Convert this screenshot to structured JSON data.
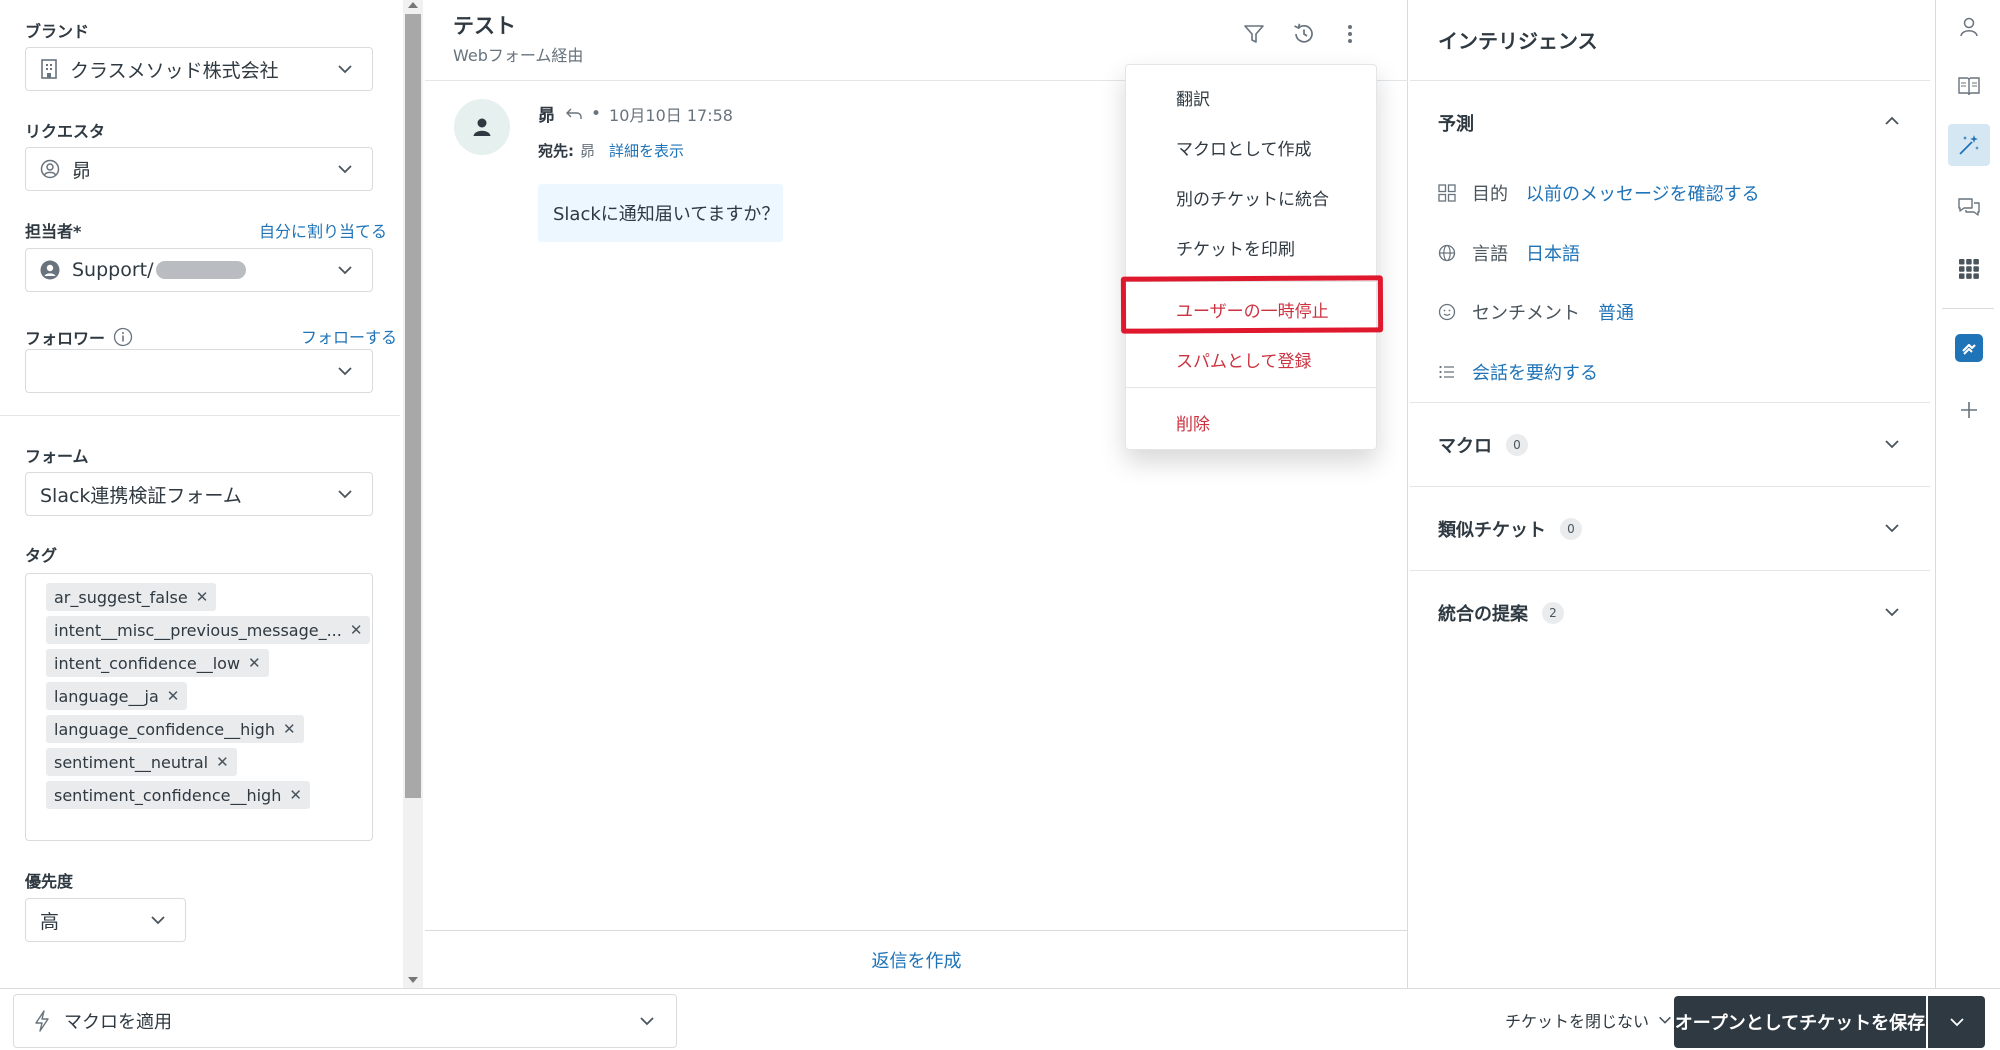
{
  "left": {
    "brand": {
      "label": "ブランド",
      "value": "クラスメソッド株式会社"
    },
    "requester": {
      "label": "リクエスタ",
      "value": "昴"
    },
    "assignee": {
      "label": "担当者*",
      "assign_self": "自分に割り当てる",
      "value": "Support/"
    },
    "followers": {
      "label": "フォロワー",
      "follow": "フォローする",
      "value": ""
    },
    "form": {
      "label": "フォーム",
      "value": "Slack連携検証フォーム"
    },
    "tags": {
      "label": "タグ",
      "items": [
        "ar_suggest_false",
        "intent__misc__previous_message_...",
        "intent_confidence__low",
        "language__ja",
        "language_confidence__high",
        "sentiment__neutral",
        "sentiment_confidence__high"
      ]
    },
    "priority": {
      "label": "優先度",
      "value": "高"
    }
  },
  "ticket": {
    "title": "テスト",
    "channel": "Webフォーム経由",
    "message": {
      "author": "昴",
      "bullet": "•",
      "timestamp": "10月10日 17:58",
      "to_label": "宛先:",
      "to_value": "昴",
      "show_details": "詳細を表示",
      "body": "Slackに通知届いてますか？"
    },
    "reply": "返信を作成"
  },
  "menu": {
    "items": [
      "翻訳",
      "マクロとして作成",
      "別のチケットに統合",
      "チケットを印刷"
    ],
    "danger": [
      "ユーザーの一時停止",
      "スパムとして登録"
    ],
    "delete": "削除",
    "highlight_color": "#e0182d"
  },
  "intel": {
    "title": "インテリジェンス",
    "prediction": {
      "title": "予測",
      "intent_label": "目的",
      "intent_value": "以前のメッセージを確認する",
      "lang_label": "言語",
      "lang_value": "日本語",
      "sentiment_label": "センチメント",
      "sentiment_value": "普通",
      "summarize": "会話を要約する"
    },
    "macros": {
      "title": "マクロ",
      "count": "0"
    },
    "similar": {
      "title": "類似チケット",
      "count": "0"
    },
    "merge": {
      "title": "統合の提案",
      "count": "2"
    }
  },
  "footer": {
    "macro": "マクロを適用",
    "close_option": "チケットを閉じない",
    "save": "オープンとしてチケットを保存"
  },
  "colors": {
    "accent": "#1f73b7",
    "danger": "#cc3340",
    "save_bg": "#2f3941",
    "bubble": "#edf7ff"
  }
}
